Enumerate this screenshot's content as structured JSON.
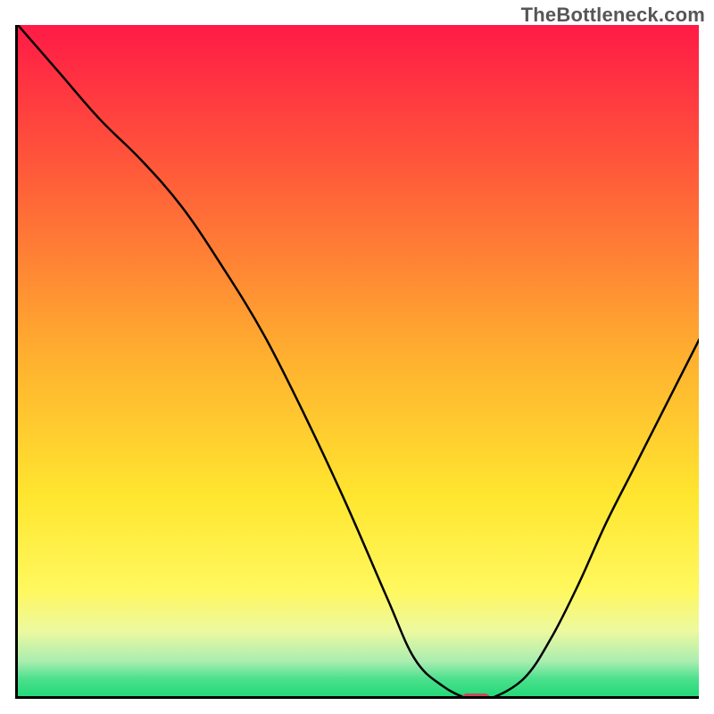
{
  "watermark": "TheBottleneck.com",
  "chart_data": {
    "type": "line",
    "title": "",
    "xlabel": "",
    "ylabel": "",
    "xlim": [
      0,
      100
    ],
    "ylim": [
      0,
      100
    ],
    "background": {
      "gradient": "vertical",
      "stops": [
        {
          "pos": 0.0,
          "color": "#ff1a46"
        },
        {
          "pos": 0.25,
          "color": "#ff6438"
        },
        {
          "pos": 0.5,
          "color": "#ffb22f"
        },
        {
          "pos": 0.7,
          "color": "#ffe62f"
        },
        {
          "pos": 0.84,
          "color": "#fff85f"
        },
        {
          "pos": 0.9,
          "color": "#ecf9a0"
        },
        {
          "pos": 0.945,
          "color": "#a8edb0"
        },
        {
          "pos": 0.97,
          "color": "#4ce08d"
        },
        {
          "pos": 1.0,
          "color": "#1ed875"
        }
      ]
    },
    "series": [
      {
        "name": "bottleneck-curve",
        "x": [
          0,
          6,
          12,
          18,
          24,
          30,
          36,
          42,
          48,
          54,
          58,
          62,
          66,
          69,
          74,
          78,
          82,
          86,
          90,
          94,
          100
        ],
        "values": [
          100,
          93,
          86,
          80,
          73,
          64,
          54,
          42,
          29,
          15,
          6,
          2,
          0,
          0,
          3,
          9,
          17,
          26,
          34,
          42,
          54
        ]
      }
    ],
    "marker": {
      "name": "optimal-point",
      "x": 67,
      "y": 0,
      "width": 4.2,
      "height": 1.6,
      "color": "#c74a5b"
    }
  }
}
